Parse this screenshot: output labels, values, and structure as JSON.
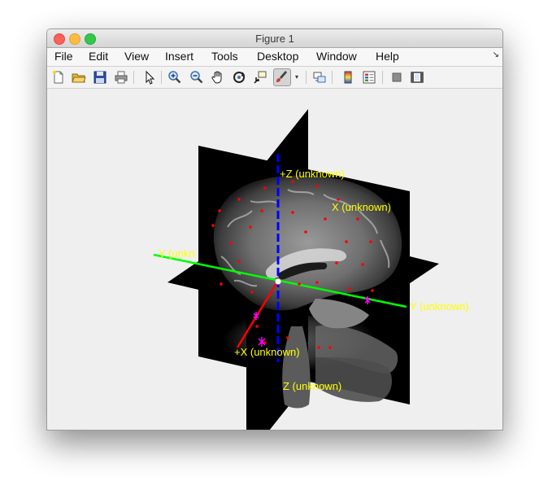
{
  "window": {
    "title": "Figure 1"
  },
  "menu": {
    "items": [
      "File",
      "Edit",
      "View",
      "Insert",
      "Tools",
      "Desktop",
      "Window",
      "Help"
    ],
    "overflow": "↘"
  },
  "toolbar": {
    "buttons": [
      "new-figure",
      "open-file",
      "save",
      "print",
      "edit-plot-arrow",
      "zoom-in",
      "zoom-out",
      "pan-hand",
      "rotate-3d",
      "data-cursor",
      "brush",
      "link-plot",
      "colorbar",
      "legend",
      "hide-plot-tools",
      "show-plot-tools"
    ],
    "brush_dropdown": "▾"
  },
  "plot": {
    "labels": {
      "plus_z": "+Z (unknown)",
      "z": "Z (unknown)",
      "plus_x": "+X (unknown)",
      "x_hidden": "X (unknown)",
      "y_right": "Y (unknown)",
      "y_left": "Y (unkn"
    },
    "colors": {
      "x_axis": "#ff0000",
      "y_axis": "#00ff00",
      "z_axis": "#0000ff",
      "labels": "#ffff00",
      "markers": "#ff00ff",
      "electrodes": "#ff0000"
    }
  }
}
